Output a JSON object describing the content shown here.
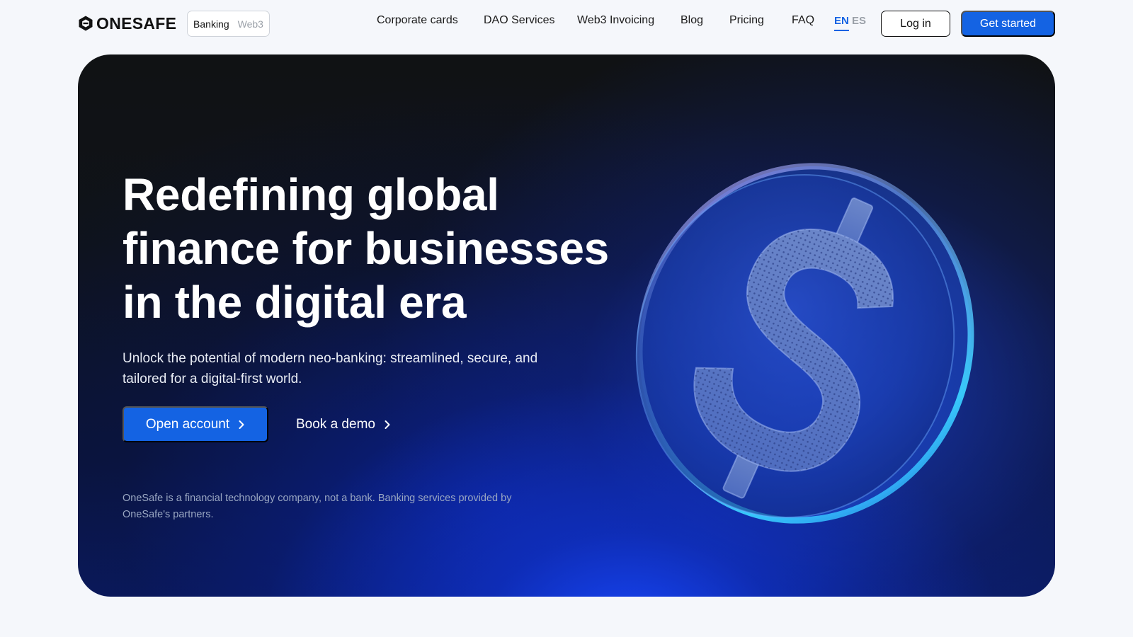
{
  "header": {
    "brand": "ONESAFE",
    "mode_switch": {
      "active": "Banking",
      "inactive": "Web3"
    },
    "nav": [
      "Corporate cards",
      "DAO Services",
      "Web3 Invoicing",
      "Blog",
      "Pricing",
      "FAQ"
    ],
    "languages": {
      "active": "EN",
      "inactive": "ES"
    },
    "login_label": "Log in",
    "get_started_label": "Get started"
  },
  "hero": {
    "title_lines": [
      "Redefining global",
      "finance for businesses",
      "in the digital era"
    ],
    "subtitle": "Unlock the potential of modern neo-banking: streamlined, secure, and tailored for a digital-first world.",
    "primary_cta": "Open account",
    "secondary_cta": "Book a demo",
    "disclaimer": "OneSafe is a financial technology company, not a bank. Banking services provided by OneSafe's partners.",
    "illustration": "dollar-coin-icon"
  },
  "colors": {
    "accent": "#1463e3",
    "text": "#111111",
    "page_bg": "#f5f7fb",
    "hero_dark": "#101214",
    "hero_blue": "#1848ff"
  }
}
